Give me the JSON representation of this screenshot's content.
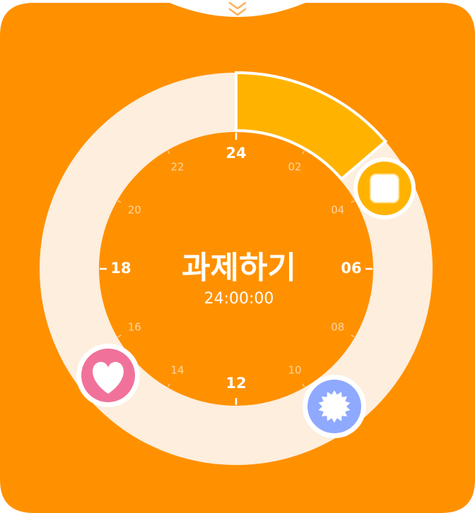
{
  "app": {
    "title": "과제하기",
    "timer": "24:00:00"
  },
  "colors": {
    "background": "#FF9100",
    "ring_track": "#FDEEDD",
    "active_segment": "#FFB300",
    "stop_button": "#FFB300",
    "heart_button": "#F0729A",
    "badge_button": "#8FA9FF"
  },
  "dial": {
    "major_labels": [
      "24",
      "06",
      "12",
      "18"
    ],
    "minor_labels": [
      "02",
      "04",
      "08",
      "10",
      "14",
      "16",
      "20",
      "22"
    ]
  },
  "active_segment": {
    "start_hour": 0,
    "end_hour": 3.3
  },
  "handles": [
    {
      "name": "stop-button",
      "icon": "stop-square-icon"
    },
    {
      "name": "heart-button",
      "icon": "heart-icon"
    },
    {
      "name": "badge-button",
      "icon": "badge-star-icon"
    }
  ],
  "top_handle": {
    "icon": "chevron-double-down-icon"
  }
}
